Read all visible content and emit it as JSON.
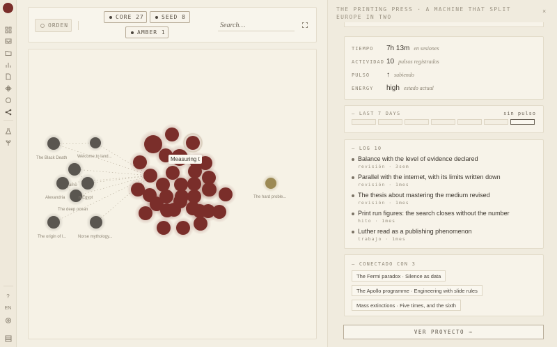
{
  "toolbar": {
    "orden_label": "ORDEN",
    "chips": [
      {
        "label": "CORE 27"
      },
      {
        "label": "SEED 8"
      },
      {
        "label": "AMBER 1"
      }
    ],
    "search_placeholder": "Search…"
  },
  "graph": {
    "tooltip": "Measuring t",
    "labels": {
      "black_death": "The Black Death",
      "welcome": "Welcome to land...",
      "alexandria": "Alexandria",
      "egypt": "n Egypt",
      "amo": "amo",
      "deep_ocean": "The deep ocean",
      "origin": "The origin of l...",
      "norse": "Norse mythology...",
      "hard_problem": "The hard proble..."
    },
    "colors": {
      "core": "#7a2e2a",
      "seed": "#5a5650",
      "amber": "#9c8a55"
    }
  },
  "panel": {
    "title": "THE PRINTING PRESS · A MACHINE THAT SPLIT EUROPE IN TWO",
    "stats": [
      {
        "key": "TIEMPO",
        "value": "7h 13m",
        "sub": "en sesiones"
      },
      {
        "key": "ACTIVIDAD",
        "value": "10",
        "sub": "pulsos registrados"
      },
      {
        "key": "PULSO",
        "value": "↑",
        "sub": "subiendo"
      },
      {
        "key": "ENERGY",
        "value": "high",
        "sub": "estado actual"
      }
    ],
    "days_heading": "— LAST 7 DAYS",
    "days_right": "sin pulso",
    "log_heading": "— LOG 10",
    "log": [
      {
        "text": "Balance with the level of evidence declared",
        "meta": "revisión · 3sem"
      },
      {
        "text": "Parallel with the internet, with its limits written down",
        "meta": "revisión · 1mes"
      },
      {
        "text": "The thesis about mastering the medium revised",
        "meta": "revisión · 1mes"
      },
      {
        "text": "Print run figures: the search closes without the number",
        "meta": "hito · 1mes"
      },
      {
        "text": "Luther read as a publishing phenomenon",
        "meta": "trabajo · 1mes"
      }
    ],
    "connected_heading": "— CONECTADO CON 3",
    "connections": [
      "The Fermi paradox · Silence as data",
      "The Apollo programme · Engineering with slide rules",
      "Mass extinctions · Five times, and the sixth"
    ],
    "cta": "VER PROYECTO →"
  },
  "rail": {
    "lang": "EN"
  }
}
